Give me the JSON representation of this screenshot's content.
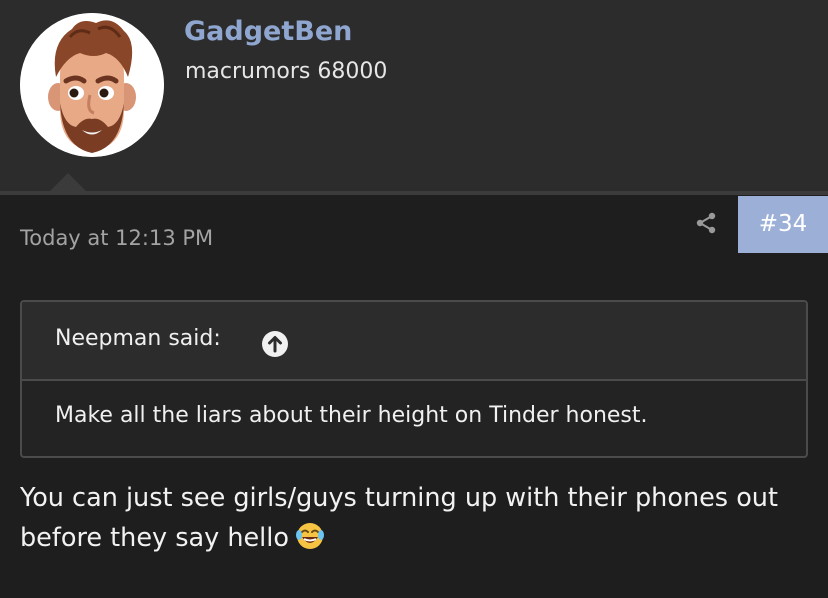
{
  "post": {
    "author": {
      "name": "GadgetBen",
      "title": "macrumors 68000",
      "avatar_icon": "memoji-avatar"
    },
    "date": "Today at 12:13 PM",
    "number": "#34",
    "share_icon": "share-icon",
    "quote": {
      "author_label": "Neepman said:",
      "jump_icon": "arrow-up-circle-icon",
      "text": "Make all the liars about their height on Tinder honest."
    },
    "message": "You can just see girls/guys turning up with their phones out before they say hello",
    "emoji_icon": "tears-of-joy-emoji"
  },
  "colors": {
    "background": "#1e1e1e",
    "header_background": "#2c2c2d",
    "username": "#8fa6d0",
    "post_number_badge": "#9cb0d7"
  }
}
